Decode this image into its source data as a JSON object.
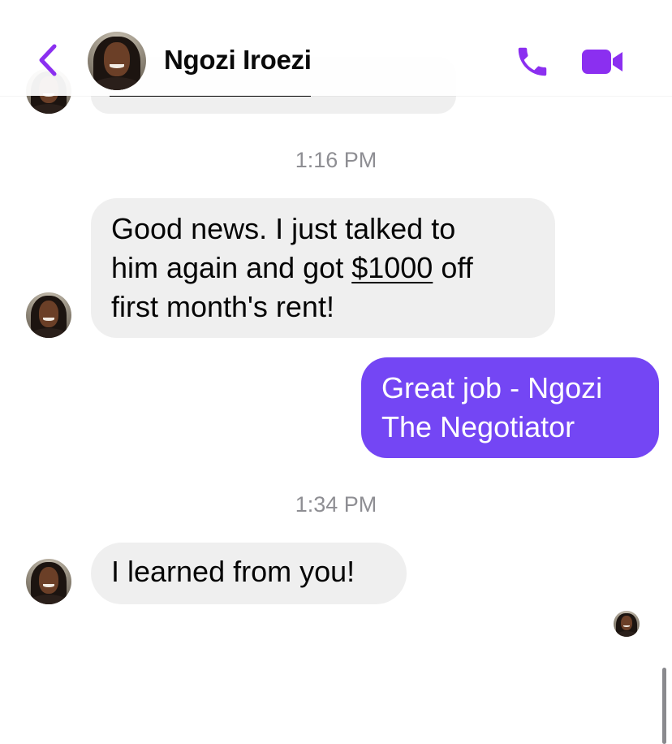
{
  "header": {
    "contact_name": "Ngozi Iroezi",
    "back_icon": "chevron-left-icon",
    "call_icon": "phone-icon",
    "video_icon": "video-camera-icon"
  },
  "messages": [
    {
      "timestamp": "1:16 PM",
      "sender": "incoming",
      "lines": [
        "Good news.  I just talked to",
        "him again and got ",
        "$1000",
        " off",
        "first month's rent!"
      ]
    },
    {
      "sender": "outgoing",
      "lines": [
        "Great job - Ngozi",
        "The Negotiator"
      ]
    },
    {
      "timestamp": "1:34 PM",
      "sender": "incoming",
      "lines": [
        "I learned from you!"
      ]
    }
  ],
  "colors": {
    "accent": "#8b2ff0",
    "outgoing_bubble": "#7446f4",
    "incoming_bubble": "#efefef",
    "timestamp_text": "#8e8e93"
  }
}
